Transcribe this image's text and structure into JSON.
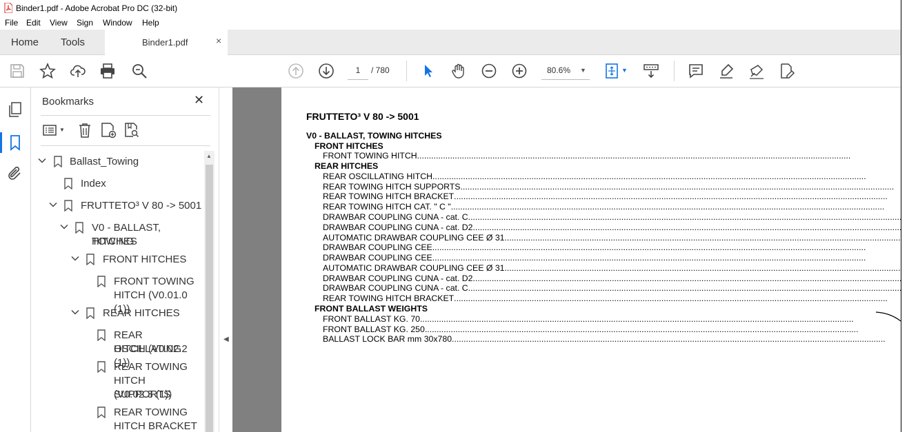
{
  "window": {
    "title": "Binder1.pdf - Adobe Acrobat Pro DC (32-bit)"
  },
  "menu": [
    "File",
    "Edit",
    "View",
    "Sign",
    "Window",
    "Help"
  ],
  "tabs": {
    "home": "Home",
    "tools": "Tools",
    "document": "Binder1.pdf",
    "close": "×"
  },
  "nav": {
    "current_page": "1",
    "total_pages": "/ 780",
    "zoom": "80.6%"
  },
  "bookmarks": {
    "title": "Bookmarks",
    "close": "✕",
    "items": [
      {
        "label": "Ballast_Towing"
      },
      {
        "label": "Index"
      },
      {
        "label": "FRUTTETO³ V 80 -> 5001"
      },
      {
        "label1": "V0 - BALLAST, TOWING",
        "label2": "HITCHES"
      },
      {
        "label": "FRONT HITCHES"
      },
      {
        "label1": "FRONT TOWING",
        "label2": "HITCH (V0.01.0 (1))"
      },
      {
        "label": "REAR HITCHES"
      },
      {
        "label1": "REAR OSCILLATING",
        "label2": "HITCH (V0.02.2 (1))"
      },
      {
        "label1": "REAR TOWING",
        "label2": "HITCH SUPPORTS",
        "label3": "(V0.02.3 (1))"
      },
      {
        "label1": "REAR TOWING",
        "label2": "HITCH BRACKET"
      }
    ]
  },
  "document": {
    "title": "FRUTTETO³ V 80 -> 5001",
    "lines": [
      {
        "text": "V0 - BALLAST, TOWING HITCHES"
      },
      {
        "text": "FRONT HITCHES"
      },
      {
        "text": "FRONT TOWING HITCH"
      },
      {
        "text": "REAR HITCHES"
      },
      {
        "text": "REAR OSCILLATING HITCH"
      },
      {
        "text": "REAR TOWING HITCH SUPPORTS"
      },
      {
        "text": "REAR TOWING HITCH BRACKET"
      },
      {
        "text": "REAR TOWING HITCH CAT. \" C \""
      },
      {
        "text": "DRAWBAR COUPLING CUNA - cat. C"
      },
      {
        "text": "DRAWBAR COUPLING CUNA - cat. D2"
      },
      {
        "text": "AUTOMATIC DRAWBAR COUPLING CEE Ø 31"
      },
      {
        "text": "DRAWBAR COUPLING CEE"
      },
      {
        "text": "DRAWBAR COUPLING CEE"
      },
      {
        "text": "AUTOMATIC DRAWBAR COUPLING CEE Ø 31"
      },
      {
        "text": "DRAWBAR COUPLING CUNA - cat. D2"
      },
      {
        "text": "DRAWBAR COUPLING CUNA - cat. C"
      },
      {
        "text": "REAR TOWING HITCH BRACKET"
      },
      {
        "text": "FRONT BALLAST WEIGHTS"
      },
      {
        "text": "FRONT BALLAST KG. 70"
      },
      {
        "text": "FRONT BALLAST KG. 250"
      },
      {
        "text": "BALLAST LOCK BAR mm 30x780"
      }
    ]
  },
  "colors": {
    "accent": "#1473e6",
    "doc_bg": "#808080",
    "pdf_red": "#d7261e"
  }
}
